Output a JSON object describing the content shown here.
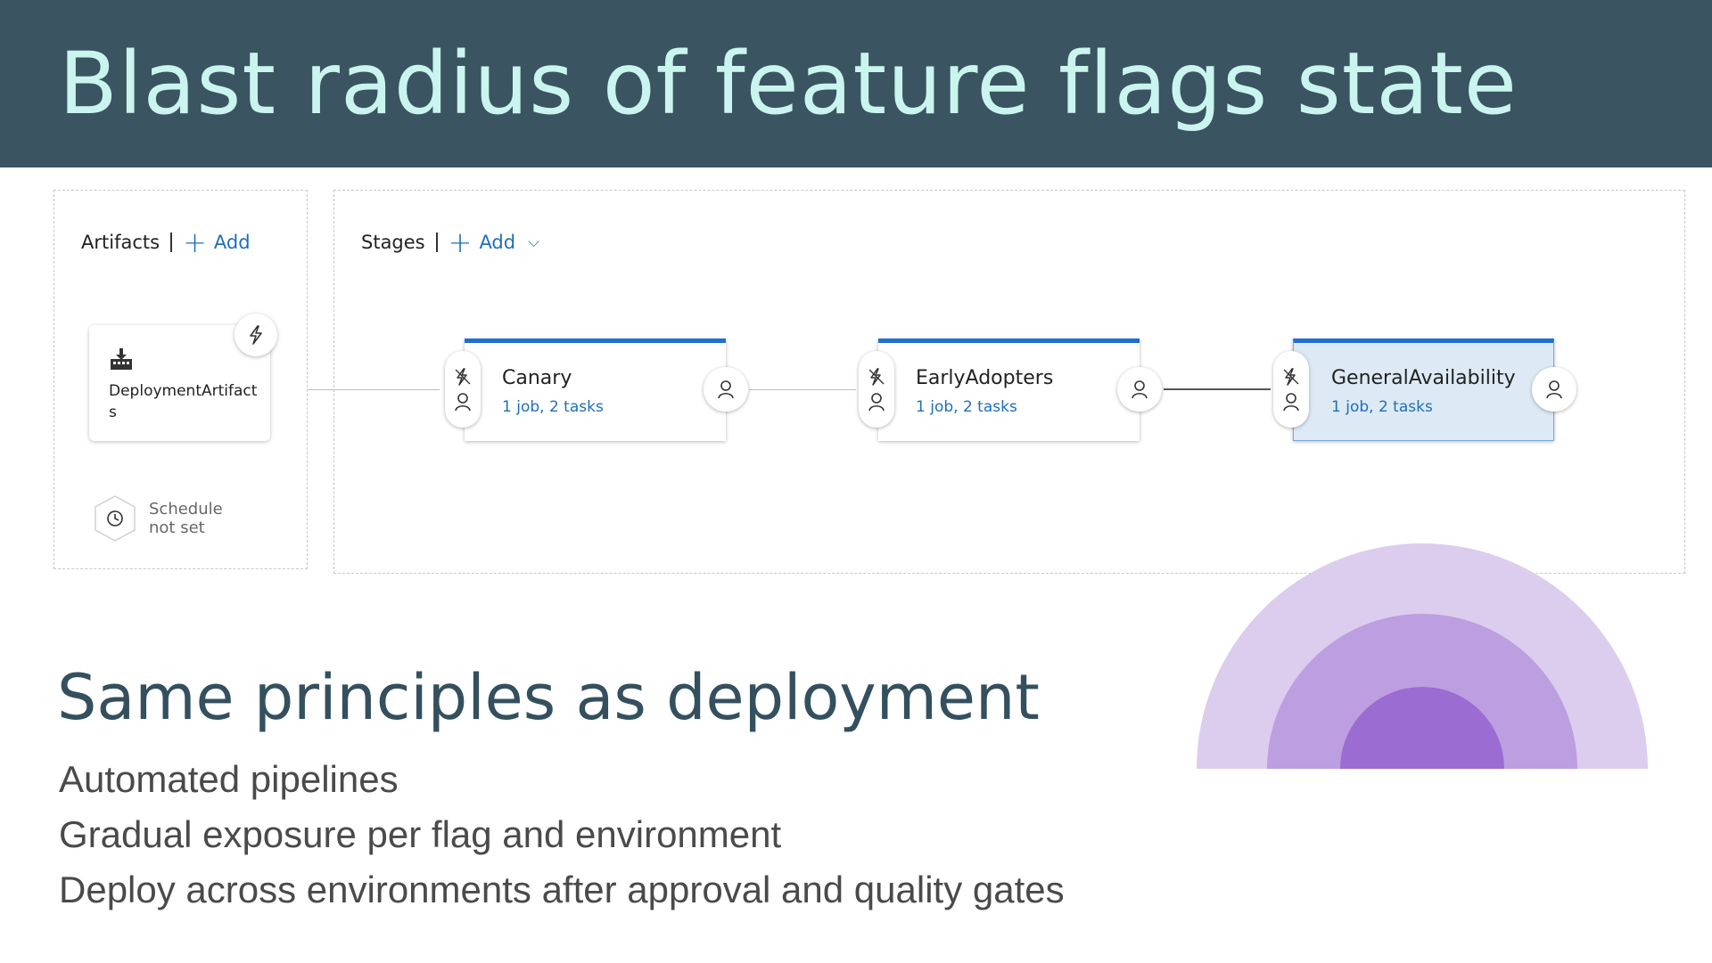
{
  "slide": {
    "title": "Blast radius of feature flags state",
    "subtitle": "Same principles as deployment",
    "bullets": [
      "Automated pipelines",
      "Gradual exposure per flag and environment",
      "Deploy across environments after approval and quality gates"
    ]
  },
  "artifacts": {
    "header": "Artifacts",
    "add_label": "Add",
    "artifact_name": "DeploymentArtifacts",
    "artifact_icon": "build-artifact-icon",
    "trigger_icon": "lightning-icon",
    "schedule_label": "Schedule\nnot set",
    "schedule_icon": "clock-icon"
  },
  "stages": {
    "header": "Stages",
    "add_label": "Add",
    "items": [
      {
        "name": "Canary",
        "meta": "1 job, 2 tasks",
        "selected": false
      },
      {
        "name": "EarlyAdopters",
        "meta": "1 job, 2 tasks",
        "selected": false
      },
      {
        "name": "GeneralAvailability",
        "meta": "1 job, 2 tasks",
        "selected": true
      }
    ]
  },
  "colors": {
    "title_bar": "#3b5461",
    "title_text": "#c9f5ee",
    "accent_blue": "#1e6fd0",
    "ring_outer": "#dccdee",
    "ring_middle": "#bd9ee0",
    "ring_inner": "#9b6cd2"
  }
}
